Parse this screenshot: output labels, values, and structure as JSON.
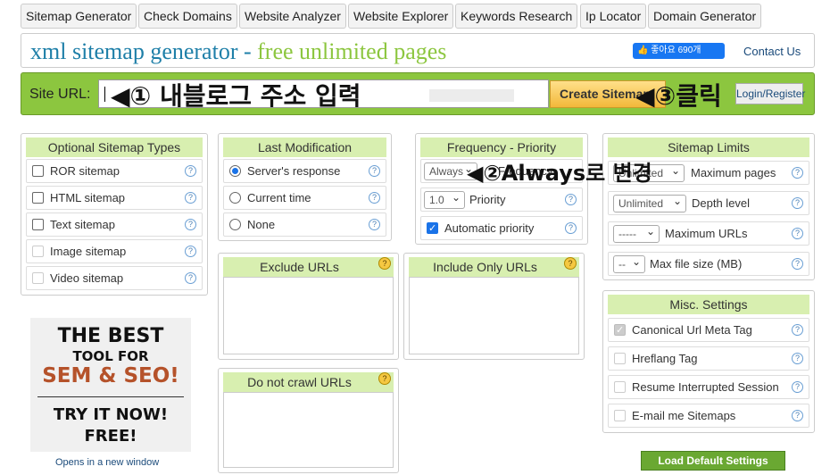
{
  "tabs": [
    "Sitemap Generator",
    "Check Domains",
    "Website Analyzer",
    "Website Explorer",
    "Keywords Research",
    "Ip Locator",
    "Domain Generator"
  ],
  "header": {
    "title_part1": "xml sitemap generator - ",
    "title_part2": "free unlimited pages",
    "like_label": "👍 좋아요 690개",
    "contact": "Contact Us"
  },
  "url_bar": {
    "label": "Site URL:",
    "create_button": "Create Sitemap",
    "login_button": "Login/Register"
  },
  "annotations": {
    "a1": "◀① 내블로그 주소 입력",
    "a2": "◀②Always로 변경",
    "a3": "◀③클릭"
  },
  "sitemap_types": {
    "title": "Optional Sitemap Types",
    "items": [
      "ROR sitemap",
      "HTML sitemap",
      "Text sitemap",
      "Image sitemap",
      "Video sitemap"
    ]
  },
  "last_mod": {
    "title": "Last Modification",
    "options": [
      "Server's response",
      "Current time",
      "None"
    ]
  },
  "frequency": {
    "title": "Frequency - Priority",
    "freq_value": "Always",
    "freq_label": "Frequency",
    "priority_value": "1.0",
    "priority_label": "Priority",
    "auto_priority": "Automatic priority"
  },
  "limits": {
    "title": "Sitemap Limits",
    "row1_label": "Maximum pages",
    "row1_value": "Unlimited",
    "depth_value": "Unlimited",
    "depth_label": "Depth level",
    "urls_value": "-----",
    "urls_label": "Maximum URLs",
    "size_value": "--",
    "size_label": "Max file size (MB)"
  },
  "exclude": {
    "title": "Exclude URLs"
  },
  "include": {
    "title": "Include Only URLs"
  },
  "nocrawl": {
    "title": "Do not crawl URLs"
  },
  "misc": {
    "title": "Misc. Settings",
    "items": [
      "Canonical Url Meta Tag",
      "Hreflang Tag",
      "Resume Interrupted Session",
      "E-mail me Sitemaps"
    ]
  },
  "ad": {
    "line1": "THE BEST",
    "line2": "TOOL FOR",
    "line3": "SEM & SEO!",
    "line4": "TRY IT NOW!",
    "line5": "FREE!",
    "opens": "Opens in a new window"
  },
  "load_default": "Load Default Settings",
  "help_glyph": "?"
}
